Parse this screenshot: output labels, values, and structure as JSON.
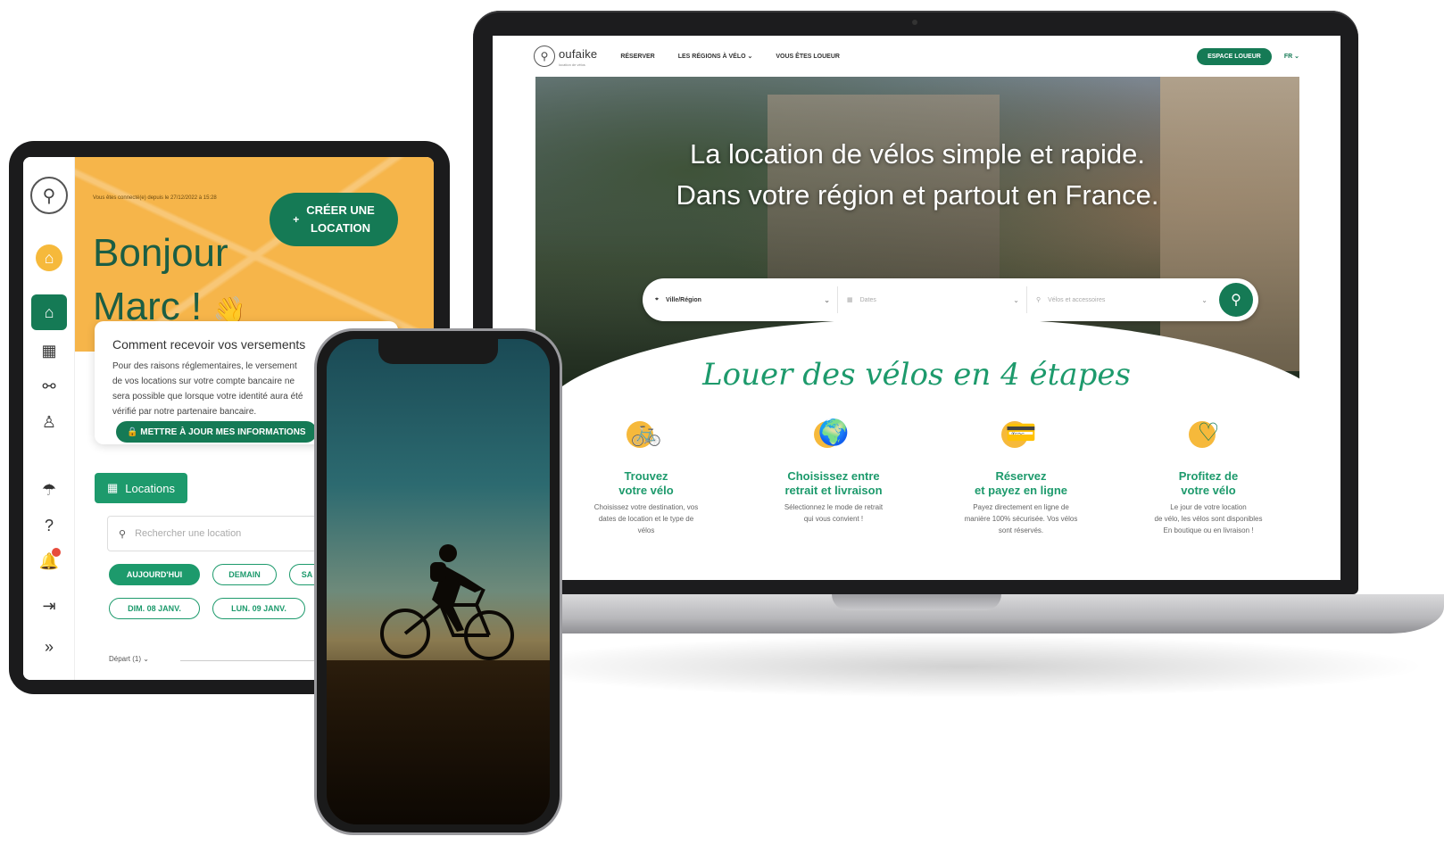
{
  "laptop": {
    "nav": {
      "logo_text": "oufaike",
      "logo_sub": "location de vélos",
      "links": [
        "RÉSERVER",
        "LES RÉGIONS À VÉLO ⌄",
        "VOUS ÊTES LOUEUR"
      ],
      "espace_loueur": "ESPACE LOUEUR",
      "lang": "FR ⌄"
    },
    "hero": {
      "title_line1": "La location de vélos simple et rapide.",
      "title_line2": "Dans votre région et partout en France."
    },
    "search": {
      "location_value": "Ville/Région",
      "dates_placeholder": "Dates",
      "bikes_placeholder": "Vélos et accessoires"
    },
    "steps_title": "Louer des vélos en 4 étapes",
    "steps": [
      {
        "icon": "bike-icon",
        "title1": "Trouvez",
        "title2": "votre vélo",
        "desc1": "Choisissez votre destination, vos",
        "desc2": "dates de location et le type de",
        "desc3": "vélos"
      },
      {
        "icon": "globe-pin-icon",
        "title1": "Choisissez entre",
        "title2": "retrait et livraison",
        "desc1": "Sélectionnez le mode de retrait",
        "desc2": "qui vous convient !",
        "desc3": ""
      },
      {
        "icon": "card-icon",
        "title1": "Réservez",
        "title2": "et payez en ligne",
        "desc1": "Payez directement en ligne de",
        "desc2": "manière 100% sécurisée. Vos vélos",
        "desc3": "sont réservés."
      },
      {
        "icon": "heart-check-icon",
        "title1": "Profitez de",
        "title2": "votre vélo",
        "desc1": "Le jour de votre location",
        "desc2": "de vélo, les vélos sont disponibles",
        "desc3": "En boutique ou en livraison !"
      }
    ]
  },
  "tablet": {
    "connected": "Vous êtes connecté(e) depuis le 27/12/2022 à 15:28",
    "hello_line1": "Bonjour",
    "hello_line2": "Marc !",
    "wave": "👋",
    "create_line1": "CRÉER UNE",
    "create_line2": "LOCATION",
    "card": {
      "title": "Comment recevoir vos versements",
      "line1": "Pour des raisons réglementaires, le versement",
      "line2": "de vos locations sur votre compte bancaire ne",
      "line3": "sera possible que lorsque votre identité aura été",
      "line4": "vérifié par notre partenaire bancaire.",
      "button": "METTRE À JOUR MES INFORMATIONS"
    },
    "locations_label": "Locations",
    "search_placeholder": "Rechercher une location",
    "chips": [
      "AUJOURD'HUI",
      "DEMAIN",
      "SA",
      "DIM. 08 JANV.",
      "LUN. 09 JANV."
    ],
    "depart": "Départ (1) ⌄"
  }
}
